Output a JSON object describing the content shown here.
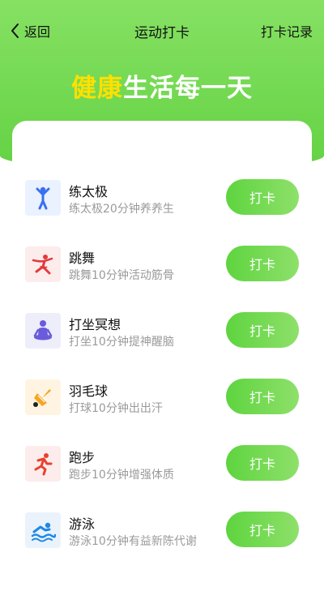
{
  "header": {
    "back_label": "返回",
    "title": "运动打卡",
    "record_label": "打卡记录"
  },
  "slogan": {
    "highlight": "健康",
    "rest": "生活每一天"
  },
  "colors": {
    "accent_green": "#64d244",
    "highlight_yellow": "#ffe000"
  },
  "items": [
    {
      "name": "练太极",
      "desc": "练太极20分钟养养生",
      "button": "打卡",
      "icon": "taichi-figure-icon",
      "icon_bg": "#eaf1ff"
    },
    {
      "name": "跳舞",
      "desc": "跳舞10分钟活动筋骨",
      "button": "打卡",
      "icon": "dancer-icon",
      "icon_bg": "#fdecec"
    },
    {
      "name": "打坐冥想",
      "desc": "打坐10分钟提神醒脑",
      "button": "打卡",
      "icon": "meditation-icon",
      "icon_bg": "#eeeefb"
    },
    {
      "name": "羽毛球",
      "desc": "打球10分钟出出汗",
      "button": "打卡",
      "icon": "badminton-shuttlecock-icon",
      "icon_bg": "#fff4e2"
    },
    {
      "name": "跑步",
      "desc": "跑步10分钟增强体质",
      "button": "打卡",
      "icon": "running-icon",
      "icon_bg": "#fdecec"
    },
    {
      "name": "游泳",
      "desc": "游泳10分钟有益新陈代谢",
      "button": "打卡",
      "icon": "swimming-icon",
      "icon_bg": "#eaf3fc"
    }
  ]
}
